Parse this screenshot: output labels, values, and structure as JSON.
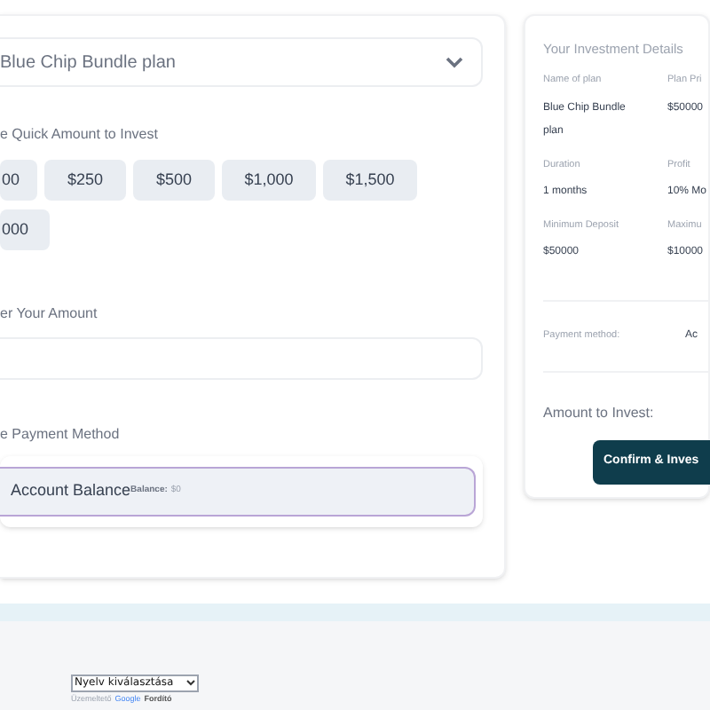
{
  "plan_select": {
    "value": "Blue Chip Bundle plan"
  },
  "quick_amount": {
    "label": "e Quick Amount to Invest",
    "options": [
      {
        "label": "00",
        "selected": false
      },
      {
        "label": "$250",
        "selected": false
      },
      {
        "label": "$500",
        "selected": false
      },
      {
        "label": "$1,000",
        "selected": false
      },
      {
        "label": "$1,500",
        "selected": false
      },
      {
        "label": "000",
        "selected": false
      }
    ]
  },
  "amount": {
    "label": "er Your Amount"
  },
  "payment": {
    "label": "e Payment Method",
    "methods": [
      {
        "name": "Account Balance",
        "balance_label": "Balance:",
        "balance": "$0",
        "selected": true
      }
    ]
  },
  "details": {
    "title": "Your Investment Details",
    "fields": [
      {
        "label": "Name of plan",
        "value": "Blue Chip Bundle plan"
      },
      {
        "label": "Plan Pri",
        "value": "$50000"
      },
      {
        "label": "Duration",
        "value": "1 months"
      },
      {
        "label": "Profit",
        "value": "10% Mo"
      },
      {
        "label": "Minimum Deposit",
        "value": "$50000"
      },
      {
        "label": "Maximu",
        "value": "$10000"
      }
    ],
    "payment_method": {
      "label": "Payment method:",
      "value": "Ac"
    },
    "amount_label": "Amount to Invest:",
    "confirm_button": "Confirm & Inves"
  },
  "footer": {
    "language_select": "Nyelv kiválasztása",
    "powered_by": "Üzemeltető",
    "google": "Google",
    "translate": "Fordító"
  }
}
